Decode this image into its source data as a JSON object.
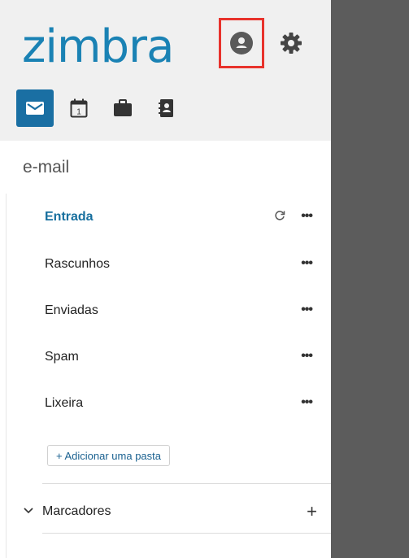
{
  "header": {
    "logo": "zimbra",
    "apps": [
      {
        "name": "mail",
        "active": true
      },
      {
        "name": "calendar",
        "day": "1"
      },
      {
        "name": "briefcase"
      },
      {
        "name": "contacts"
      }
    ]
  },
  "section": {
    "title": "e-mail"
  },
  "folders": [
    {
      "label": "Entrada",
      "active": true
    },
    {
      "label": "Rascunhos"
    },
    {
      "label": "Enviadas"
    },
    {
      "label": "Spam"
    },
    {
      "label": "Lixeira"
    }
  ],
  "more_label": "•••",
  "add_folder_label": "+ Adicionar uma pasta",
  "tags": {
    "label": "Marcadores",
    "add": "+"
  },
  "colors": {
    "brand": "#1a82b4",
    "highlight": "#e8322c",
    "overlay": "#5c5c5c"
  }
}
